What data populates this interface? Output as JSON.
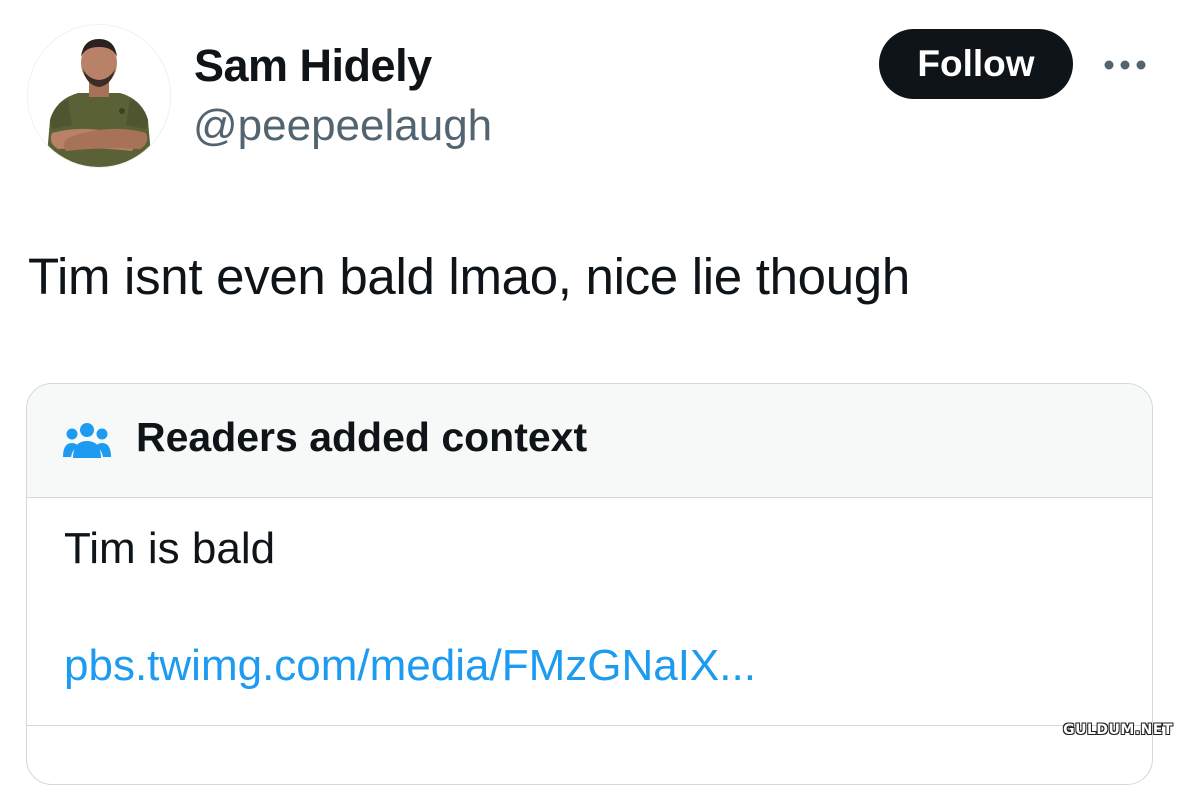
{
  "author": {
    "display_name": "Sam Hidely",
    "handle": "@peepeelaugh"
  },
  "actions": {
    "follow_label": "Follow",
    "more_icon": "ellipsis-icon"
  },
  "tweet": {
    "text": "Tim isnt even bald lmao, nice lie though"
  },
  "community_note": {
    "icon": "readers-group-icon",
    "title": "Readers added context",
    "body": "Tim is bald",
    "link": "pbs.twimg.com/media/FMzGNaIX..."
  },
  "watermark": "GULDUM.NET",
  "colors": {
    "text_primary": "#0f1419",
    "text_secondary": "#536471",
    "link": "#1d9bf0",
    "follow_bg": "#0f1419",
    "note_header_bg": "#f7f9f9",
    "border": "#cfd9de"
  }
}
